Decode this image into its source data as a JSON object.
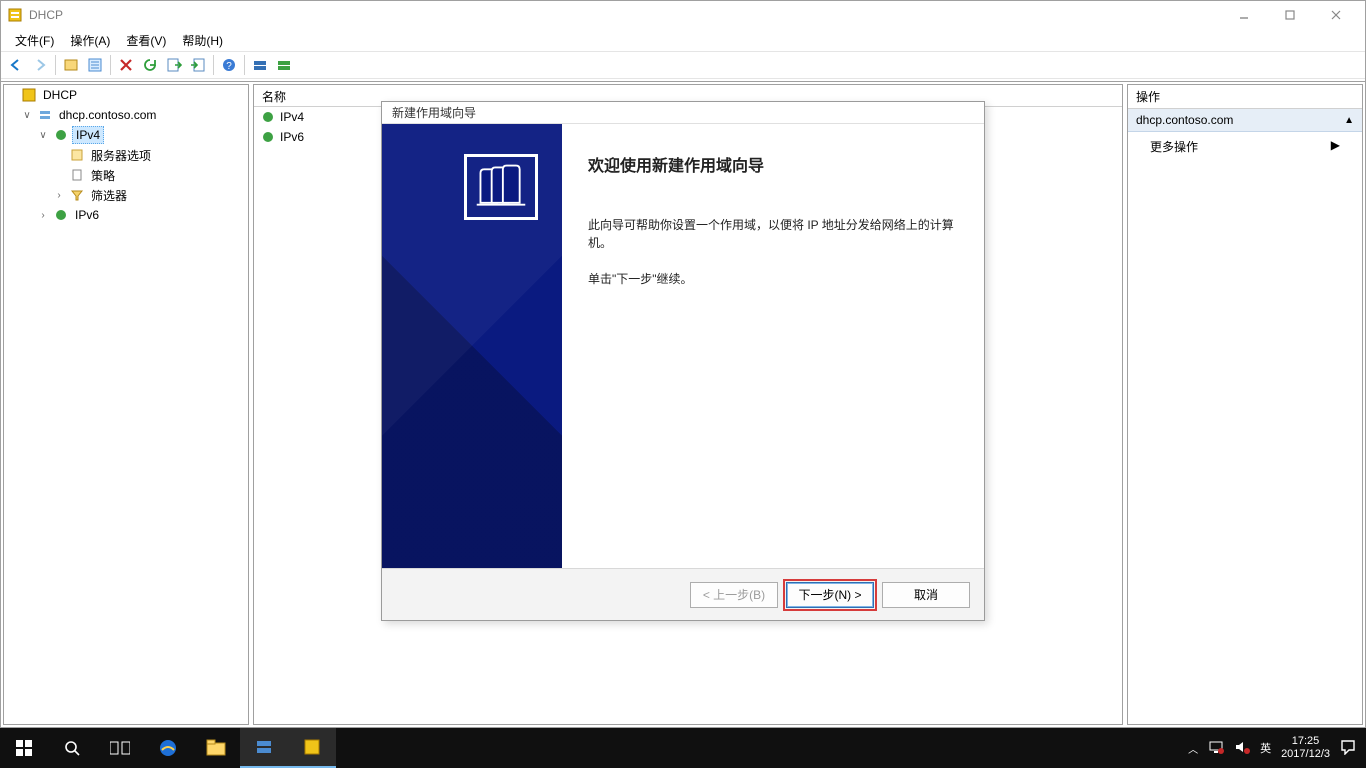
{
  "window": {
    "title": "DHCP"
  },
  "menu": {
    "file": "文件(F)",
    "action": "操作(A)",
    "view": "查看(V)",
    "help": "帮助(H)"
  },
  "tree": {
    "root": "DHCP",
    "server": "dhcp.contoso.com",
    "ipv4": "IPv4",
    "ipv4_children": {
      "server_options": "服务器选项",
      "policies": "策略",
      "filters": "筛选器"
    },
    "ipv6": "IPv6"
  },
  "list": {
    "header": "名称",
    "items": [
      "IPv4",
      "IPv6"
    ]
  },
  "actions": {
    "header": "操作",
    "selected": "dhcp.contoso.com",
    "more": "更多操作"
  },
  "wizard": {
    "title": "新建作用域向导",
    "heading": "欢迎使用新建作用域向导",
    "body1": "此向导可帮助你设置一个作用域，以便将 IP 地址分发给网络上的计算机。",
    "body2": "单击\"下一步\"继续。",
    "back": "< 上一步(B)",
    "next": "下一步(N) >",
    "cancel": "取消"
  },
  "taskbar": {
    "ime": "英",
    "time": "17:25",
    "date": "2017/12/3"
  }
}
